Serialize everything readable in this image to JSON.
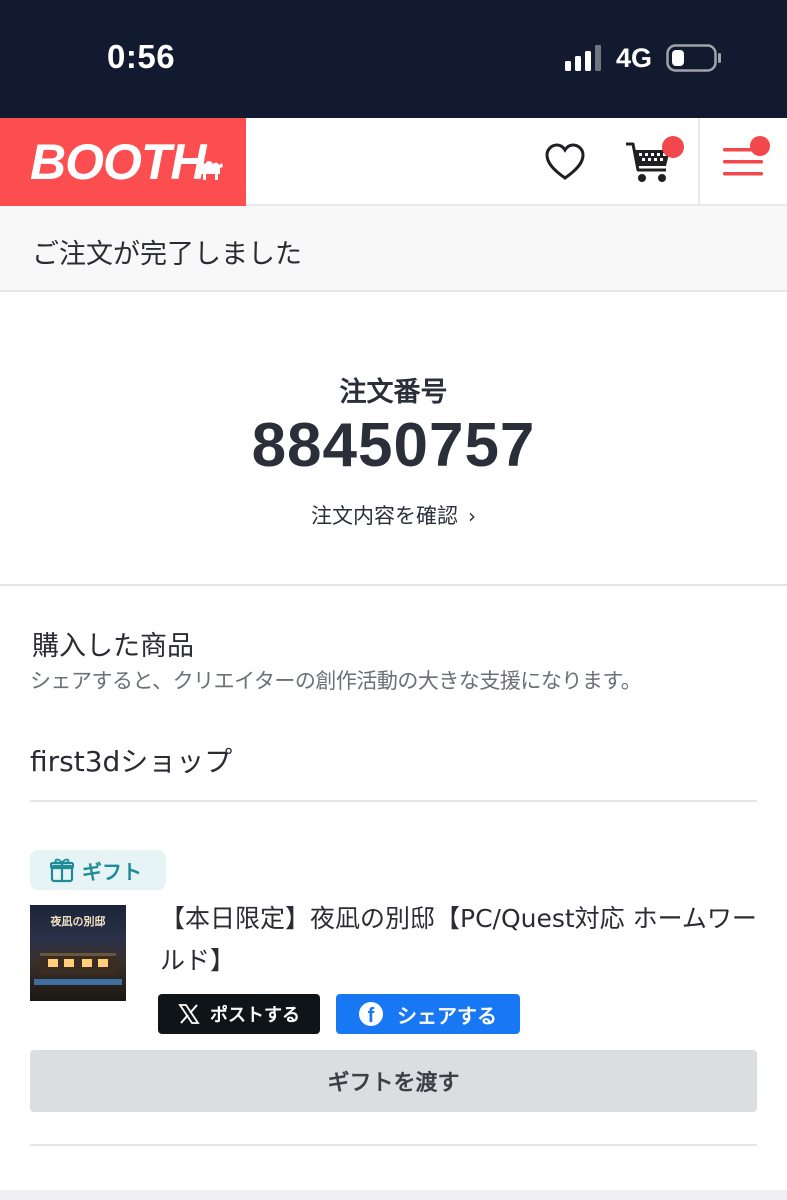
{
  "status_bar": {
    "time": "0:56",
    "network": "4G"
  },
  "header": {
    "logo_text": "BOOTH",
    "brand_color": "#fc4d50",
    "icons": [
      "heart-icon",
      "cart-icon",
      "menu-icon"
    ]
  },
  "banner": {
    "text": "ご注文が完了しました"
  },
  "order": {
    "label": "注文番号",
    "number": "88450757",
    "details_link": "注文内容を確認"
  },
  "purchased": {
    "title": "購入した商品",
    "subtitle": "シェアすると、クリエイターの創作活動の大きな支援になります。",
    "shop_name": "first3dショップ",
    "gift_badge": "ギフト",
    "thumbnail_title": "夜凪の別邸",
    "item_title": "【本日限定】夜凪の別邸【PC/Quest対応 ホームワールド】",
    "share_x_label": "ポストする",
    "share_fb_label": "シェアする",
    "gift_button": "ギフトを渡す"
  }
}
